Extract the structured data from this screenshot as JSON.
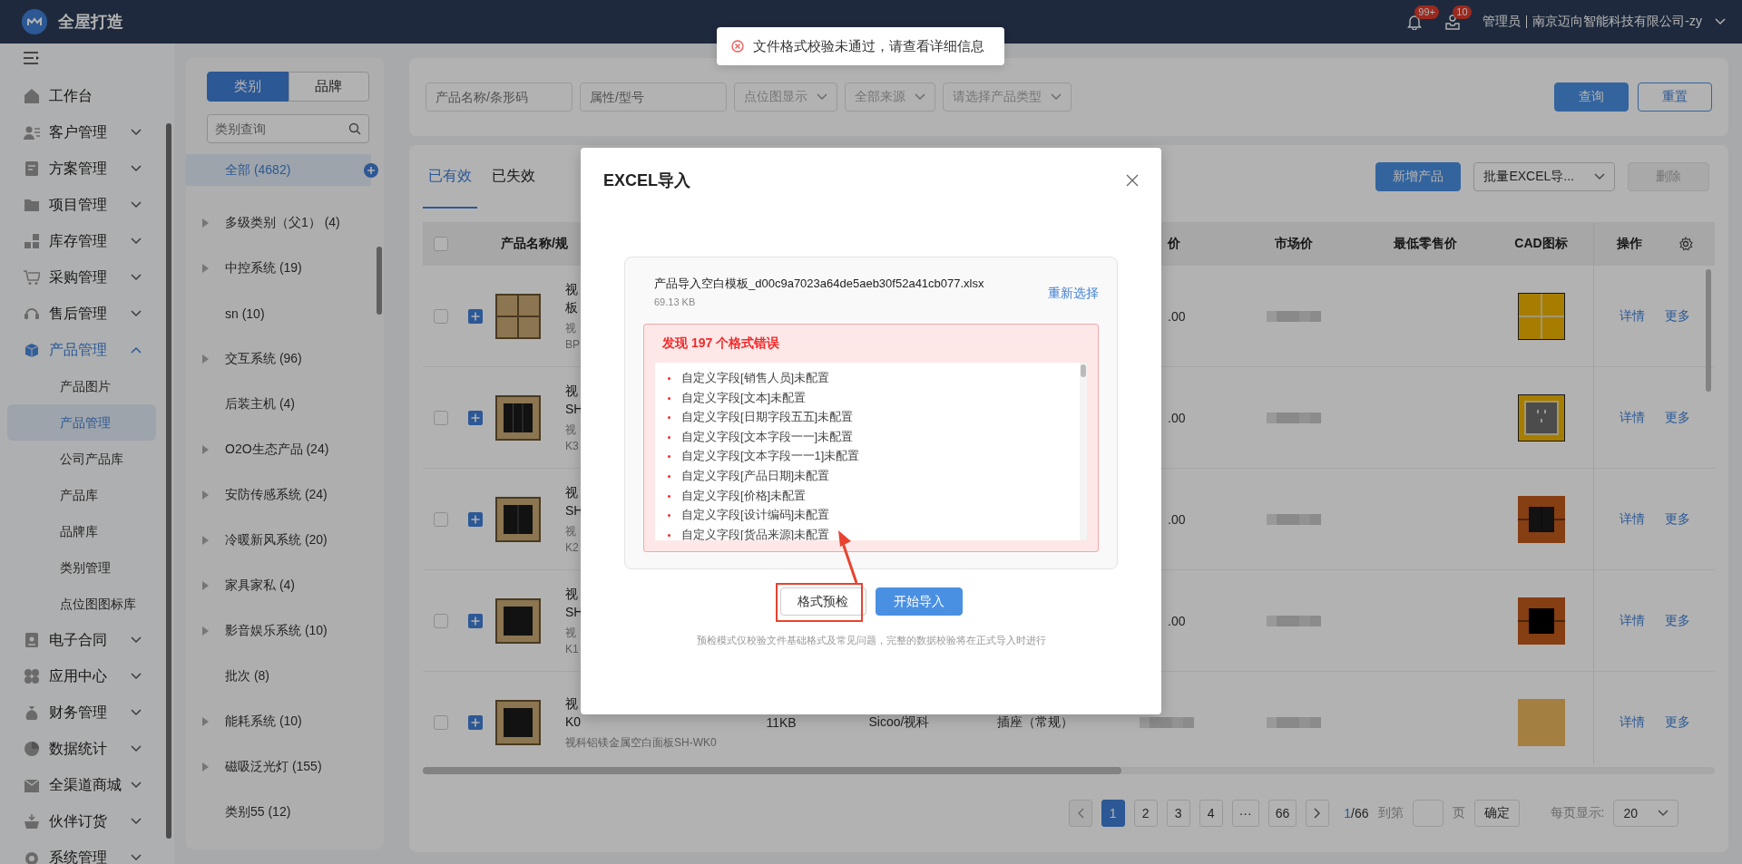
{
  "header": {
    "title": "全屋打造",
    "notification_count": "99+",
    "message_count": "10",
    "user": "管理员",
    "company": "南京迈向智能科技有限公司-zy"
  },
  "sidebar": {
    "items": [
      {
        "label": "工作台",
        "kind": "link"
      },
      {
        "label": "客户管理",
        "kind": "group",
        "expanded": false
      },
      {
        "label": "方案管理",
        "kind": "group",
        "expanded": false
      },
      {
        "label": "项目管理",
        "kind": "group",
        "expanded": false
      },
      {
        "label": "库存管理",
        "kind": "group",
        "expanded": false
      },
      {
        "label": "采购管理",
        "kind": "group",
        "expanded": false
      },
      {
        "label": "售后管理",
        "kind": "group",
        "expanded": false
      },
      {
        "label": "产品管理",
        "kind": "group",
        "expanded": true,
        "children": [
          {
            "label": "产品图片",
            "selected": false
          },
          {
            "label": "产品管理",
            "selected": true
          },
          {
            "label": "公司产品库",
            "selected": false
          },
          {
            "label": "产品库",
            "selected": false
          },
          {
            "label": "品牌库",
            "selected": false
          },
          {
            "label": "类别管理",
            "selected": false
          },
          {
            "label": "点位图图标库",
            "selected": false
          }
        ]
      },
      {
        "label": "电子合同",
        "kind": "group",
        "expanded": false
      },
      {
        "label": "应用中心",
        "kind": "group",
        "expanded": false
      },
      {
        "label": "财务管理",
        "kind": "group",
        "expanded": false
      },
      {
        "label": "数据统计",
        "kind": "group",
        "expanded": false
      },
      {
        "label": "全渠道商城",
        "kind": "group",
        "expanded": false
      },
      {
        "label": "伙伴订货",
        "kind": "group",
        "expanded": false
      },
      {
        "label": "系统管理",
        "kind": "group",
        "expanded": false
      }
    ]
  },
  "category_panel": {
    "tabs": [
      {
        "label": "类别",
        "selected": true
      },
      {
        "label": "品牌",
        "selected": false
      }
    ],
    "search": {
      "placeholder": "类别查询"
    },
    "items": [
      {
        "label": "全部 (4682)",
        "expandable": false,
        "selected": true
      },
      {
        "label": "多级类别（父1） (4)",
        "expandable": true,
        "selected": false
      },
      {
        "label": "中控系统 (19)",
        "expandable": true,
        "selected": false
      },
      {
        "label": "sn (10)",
        "expandable": false,
        "selected": false
      },
      {
        "label": "交互系统 (96)",
        "expandable": true,
        "selected": false
      },
      {
        "label": "后装主机 (4)",
        "expandable": false,
        "selected": false
      },
      {
        "label": "O2O生态产品 (24)",
        "expandable": true,
        "selected": false
      },
      {
        "label": "安防传感系统 (24)",
        "expandable": true,
        "selected": false
      },
      {
        "label": "冷暖新风系统 (20)",
        "expandable": true,
        "selected": false
      },
      {
        "label": "家具家私 (4)",
        "expandable": true,
        "selected": false
      },
      {
        "label": "影音娱乐系统 (10)",
        "expandable": true,
        "selected": false
      },
      {
        "label": "批次 (8)",
        "expandable": false,
        "selected": false
      },
      {
        "label": "能耗系统 (10)",
        "expandable": true,
        "selected": false
      },
      {
        "label": "磁吸泛光灯 (155)",
        "expandable": true,
        "selected": false
      },
      {
        "label": "类别55 (12)",
        "expandable": false,
        "selected": false
      }
    ]
  },
  "filters": {
    "fields": [
      {
        "kind": "input",
        "placeholder": "产品名称/条形码"
      },
      {
        "kind": "input",
        "placeholder": "属性/型号"
      },
      {
        "kind": "select",
        "placeholder": "点位图显示"
      },
      {
        "kind": "select",
        "placeholder": "全部来源"
      },
      {
        "kind": "select",
        "placeholder": "请选择产品类型"
      }
    ],
    "buttons": [
      {
        "label": "查询",
        "kind": "primary"
      },
      {
        "label": "重置",
        "kind": "outline"
      }
    ]
  },
  "product_list": {
    "tabs": [
      {
        "label": "已有效",
        "selected": true
      },
      {
        "label": "已失效",
        "selected": false
      }
    ],
    "actions": [
      {
        "label": "新增产品",
        "kind": "primary",
        "disabled": false
      },
      {
        "label": "批量EXCEL导...",
        "kind": "dropdown",
        "disabled": false
      },
      {
        "label": "删除",
        "kind": "plain",
        "disabled": true
      }
    ],
    "select_all": {
      "checked": false
    },
    "columns": {
      "name": "产品名称/规",
      "price": "价",
      "market_price": "市场价",
      "min_retail_price": "最低零售价",
      "cad": "CAD图标",
      "operations": "操作"
    },
    "rows": [
      {
        "checked": false,
        "name_lines": [
          "视",
          "板"
        ],
        "sub_lines": [
          "视",
          "BP"
        ],
        "price": {
          "kind": "text",
          "text": ".00"
        },
        "operations": [
          "详情",
          "更多"
        ]
      },
      {
        "checked": false,
        "name_lines": [
          "视",
          "SH"
        ],
        "sub_lines": [
          "视",
          "K3"
        ],
        "price": {
          "kind": "text",
          "text": ".00"
        },
        "operations": [
          "详情",
          "更多"
        ]
      },
      {
        "checked": false,
        "name_lines": [
          "视",
          "SH"
        ],
        "sub_lines": [
          "视",
          "K2"
        ],
        "price": {
          "kind": "text",
          "text": ".00"
        },
        "operations": [
          "详情",
          "更多"
        ]
      },
      {
        "checked": false,
        "name_lines": [
          "视",
          "SH"
        ],
        "sub_lines": [
          "视",
          "K1"
        ],
        "price": {
          "kind": "text",
          "text": ".00"
        },
        "operations": [
          "详情",
          "更多"
        ]
      },
      {
        "checked": false,
        "name_lines": [
          "视",
          "K0"
        ],
        "sub_lines": [
          "视科铝镁金属空白面板SH-WK0"
        ],
        "size": "11KB",
        "brand": "Sicoo/视科",
        "type": "插座（常规）",
        "price": {
          "kind": "redacted"
        },
        "operations": [
          "详情",
          "更多"
        ]
      }
    ],
    "pagination": {
      "pages": [
        {
          "label": "1",
          "selected": true
        },
        {
          "label": "2",
          "selected": false
        },
        {
          "label": "3",
          "selected": false
        },
        {
          "label": "4",
          "selected": false
        },
        {
          "label": "···",
          "selected": false
        },
        {
          "label": "66",
          "selected": false
        }
      ],
      "current": "1",
      "total": "/66",
      "goto_label": "到第",
      "page_label": "页",
      "confirm": "确定",
      "page_size_label": "每页显示:",
      "page_size": "20"
    }
  },
  "modal": {
    "title": "EXCEL导入",
    "file": {
      "name": "产品导入空白模板_d00c9a7023a64de5aeb30f52a41cb077.xlsx",
      "size": "69.13 KB",
      "reselect": "重新选择"
    },
    "error_title": "发现 197 个格式错误",
    "errors": [
      "自定义字段[销售人员]未配置",
      "自定义字段[文本]未配置",
      "自定义字段[日期字段五五]未配置",
      "自定义字段[文本字段一一]未配置",
      "自定义字段[文本字段一一1]未配置",
      "自定义字段[产品日期]未配置",
      "自定义字段[价格]未配置",
      "自定义字段[设计编码]未配置",
      "自定义字段[货品来源]未配置"
    ],
    "buttons": [
      {
        "label": "格式预检",
        "kind": "outline"
      },
      {
        "label": "开始导入",
        "kind": "primary"
      }
    ],
    "hint": "预检模式仅校验文件基础格式及常见问题，完整的数据校验将在正式导入时进行",
    "annotations": {
      "highlight_box": true,
      "arrow": true
    }
  },
  "toast": {
    "kind": "error",
    "text": "文件格式校验未通过，请查看详细信息"
  }
}
